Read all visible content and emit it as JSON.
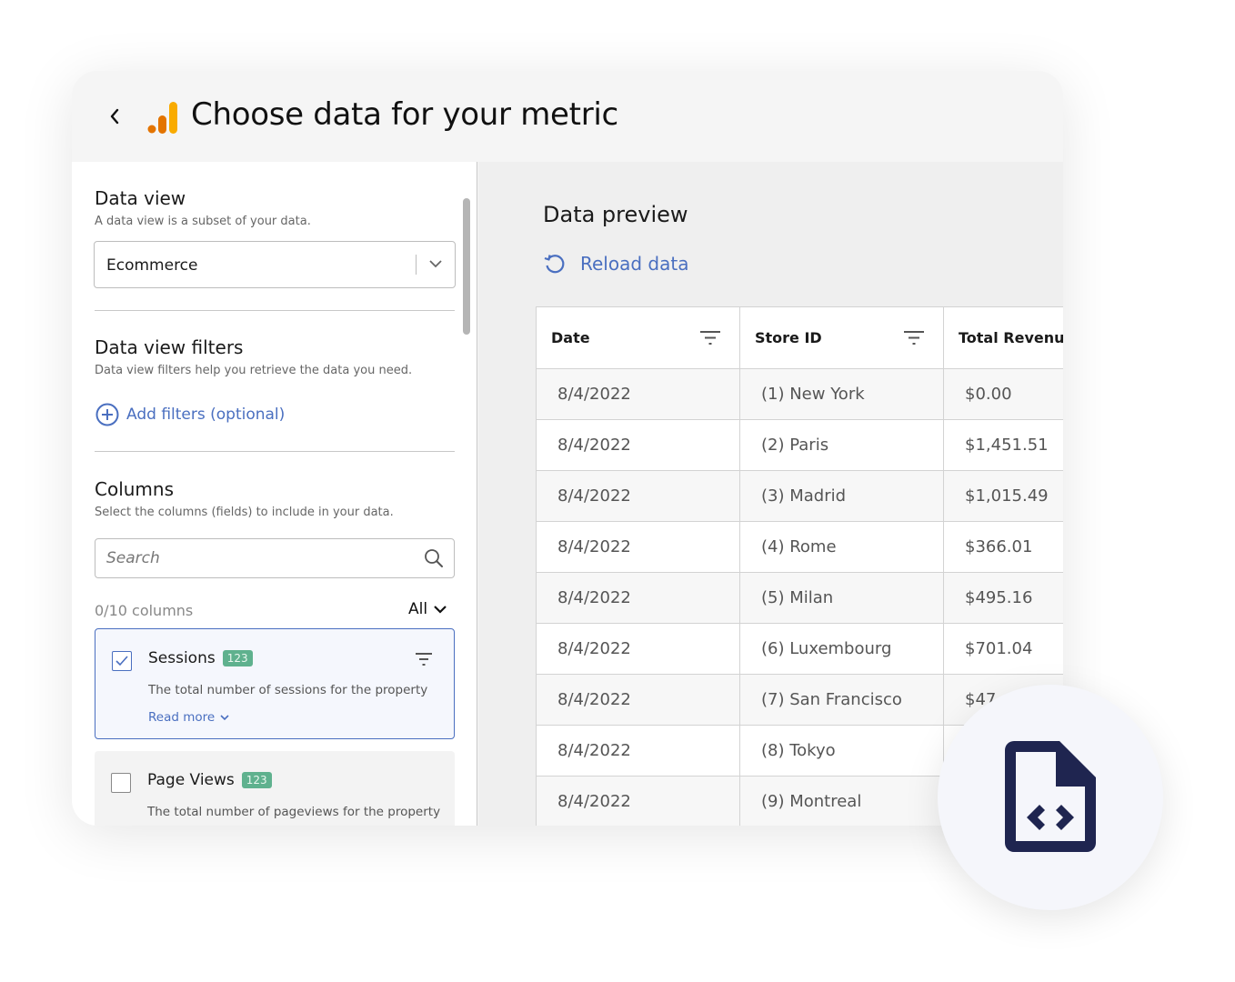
{
  "header": {
    "title": "Choose data for your metric",
    "back_icon": "chevron-left-icon",
    "logo_icon": "analytics-bars-logo",
    "logo_colors": [
      "#e37400",
      "#f9ab00"
    ]
  },
  "left_panel": {
    "data_view": {
      "title": "Data view",
      "subtitle": "A data view is a subset of your data.",
      "selected": "Ecommerce"
    },
    "filters": {
      "title": "Data view filters",
      "subtitle": "Data view filters help you retrieve the data you need.",
      "add_label": "Add filters (optional)"
    },
    "columns": {
      "title": "Columns",
      "subtitle": "Select the columns (fields) to include in your data.",
      "search_placeholder": "Search",
      "count_label": "0/10 columns",
      "filter_label": "All",
      "items": [
        {
          "name": "Sessions",
          "badge": "123",
          "description": "The total number of sessions for the property",
          "read_more": "Read more",
          "checked": true
        },
        {
          "name": "Page Views",
          "badge": "123",
          "description": "The total number of pageviews for the property",
          "checked": false
        }
      ]
    }
  },
  "right_panel": {
    "title": "Data preview",
    "reload_label": "Reload data",
    "table": {
      "headers": [
        "Date",
        "Store ID",
        "Total Revenue"
      ],
      "rows": [
        [
          "8/4/2022",
          "(1) New York",
          "$0.00"
        ],
        [
          "8/4/2022",
          "(2) Paris",
          "$1,451.51"
        ],
        [
          "8/4/2022",
          "(3) Madrid",
          "$1,015.49"
        ],
        [
          "8/4/2022",
          "(4) Rome",
          "$366.01"
        ],
        [
          "8/4/2022",
          "(5) Milan",
          "$495.16"
        ],
        [
          "8/4/2022",
          "(6) Luxembourg",
          "$701.04"
        ],
        [
          "8/4/2022",
          "(7) San Francisco",
          "$47"
        ],
        [
          "8/4/2022",
          "(8) Tokyo",
          ""
        ],
        [
          "8/4/2022",
          "(9) Montreal",
          ""
        ]
      ]
    }
  },
  "overlay": {
    "icon": "file-code-icon",
    "icon_color": "#1f2550"
  },
  "colors": {
    "accent": "#4a6fc0",
    "badge": "#5fb18e"
  }
}
